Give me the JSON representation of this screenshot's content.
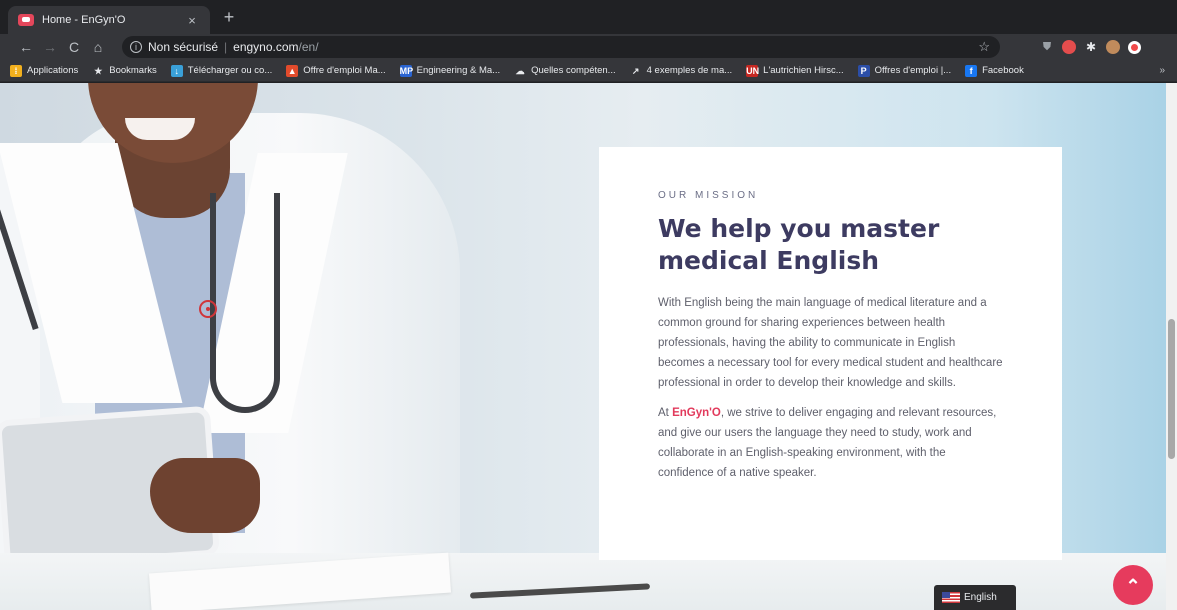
{
  "browser": {
    "tab_title": "Home - EnGyn'O",
    "tab_close": "×",
    "new_tab": "+",
    "nav_back": "←",
    "nav_forward": "→",
    "nav_reload": "C",
    "nav_home": "⌂",
    "omnibox": {
      "security_label": "Non sécurisé",
      "separator": "|",
      "host": "engyno.com",
      "path": "/en/"
    },
    "star": "☆"
  },
  "bookmarks": [
    {
      "label": "Applications",
      "icon": "apps-grid-icon",
      "color": "#f2b01e",
      "glyph": "⁞"
    },
    {
      "label": "Bookmarks",
      "icon": "star-icon",
      "color": "transparent",
      "glyph": "★"
    },
    {
      "label": "Télécharger ou co...",
      "icon": "download-site-icon",
      "color": "#3aa0d8",
      "glyph": "↓"
    },
    {
      "label": "Offre d'emploi Ma...",
      "icon": "warning-site-icon",
      "color": "#e24b2c",
      "glyph": "▲"
    },
    {
      "label": "Engineering & Ma...",
      "icon": "mp-site-icon",
      "color": "#2a64d1",
      "glyph": "MP"
    },
    {
      "label": "Quelles compéten...",
      "icon": "cloud-site-icon",
      "color": "transparent",
      "glyph": "☁"
    },
    {
      "label": "4 exemples de ma...",
      "icon": "arrow-site-icon",
      "color": "transparent",
      "glyph": "↗"
    },
    {
      "label": "L'autrichien Hirsc...",
      "icon": "un-site-icon",
      "color": "#c52822",
      "glyph": "UN"
    },
    {
      "label": "Offres d'emploi |...",
      "icon": "p-site-icon",
      "color": "#2b4ea8",
      "glyph": "P"
    },
    {
      "label": "Facebook",
      "icon": "facebook-icon",
      "color": "#1877f2",
      "glyph": "f"
    }
  ],
  "bookmarks_more": "»",
  "mission": {
    "eyebrow": "OUR MISSION",
    "heading_line1": "We help you master",
    "heading_line2": "medical English",
    "para1": "With English being the main language of medical literature and a common ground for sharing experiences between health professionals, having the ability to communicate in English becomes a necessary tool for every medical student and healthcare professional in order to develop their knowledge and skills.",
    "para2_prefix": "At ",
    "para2_brand": "EnGyn'O",
    "para2_rest": ", we strive to deliver engaging and relevant resources, and give our users the language they need to study, work and collaborate in an English-speaking environment, with the confidence of a native speaker."
  },
  "language_switcher": {
    "label": "English"
  },
  "back_to_top": {
    "glyph": "⌃"
  },
  "colors": {
    "accent": "#e63b5d",
    "heading": "#3d3b61",
    "body_text": "#5e5f6b"
  }
}
